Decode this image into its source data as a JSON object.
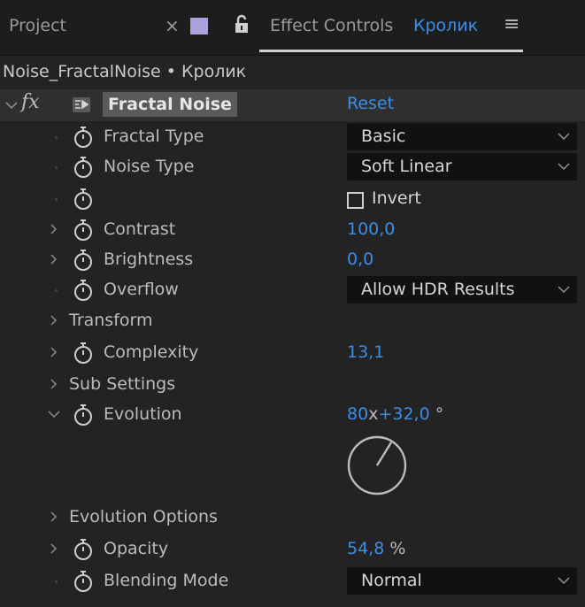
{
  "tabs": {
    "project": "Project",
    "close": "×",
    "effect_controls": "Effect Controls",
    "layer": "Кролик",
    "menu": "≡"
  },
  "path": "Noise_FractalNoise • Кролик",
  "effect": {
    "name": "Fractal Noise",
    "reset": "Reset"
  },
  "params": {
    "fractal_type": {
      "label": "Fractal Type",
      "value": "Basic"
    },
    "noise_type": {
      "label": "Noise Type",
      "value": "Soft Linear"
    },
    "invert": {
      "label": "Invert",
      "checked": false
    },
    "contrast": {
      "label": "Contrast",
      "value": "100,0"
    },
    "brightness": {
      "label": "Brightness",
      "value": "0,0"
    },
    "overflow": {
      "label": "Overflow",
      "value": "Allow HDR Results"
    },
    "transform": {
      "label": "Transform"
    },
    "complexity": {
      "label": "Complexity",
      "value": "13,1"
    },
    "sub_settings": {
      "label": "Sub Settings"
    },
    "evolution": {
      "label": "Evolution",
      "revolutions": "80",
      "x": "x",
      "degrees": "+32,0",
      "deg_sign": "°"
    },
    "evolution_options": {
      "label": "Evolution Options"
    },
    "opacity": {
      "label": "Opacity",
      "value": "54,8",
      "unit": "%"
    },
    "blending_mode": {
      "label": "Blending Mode",
      "value": "Normal"
    }
  },
  "colors": {
    "value_blue": "#3b8ee6",
    "swatch": "#a9a2dc",
    "background": "#232323"
  }
}
